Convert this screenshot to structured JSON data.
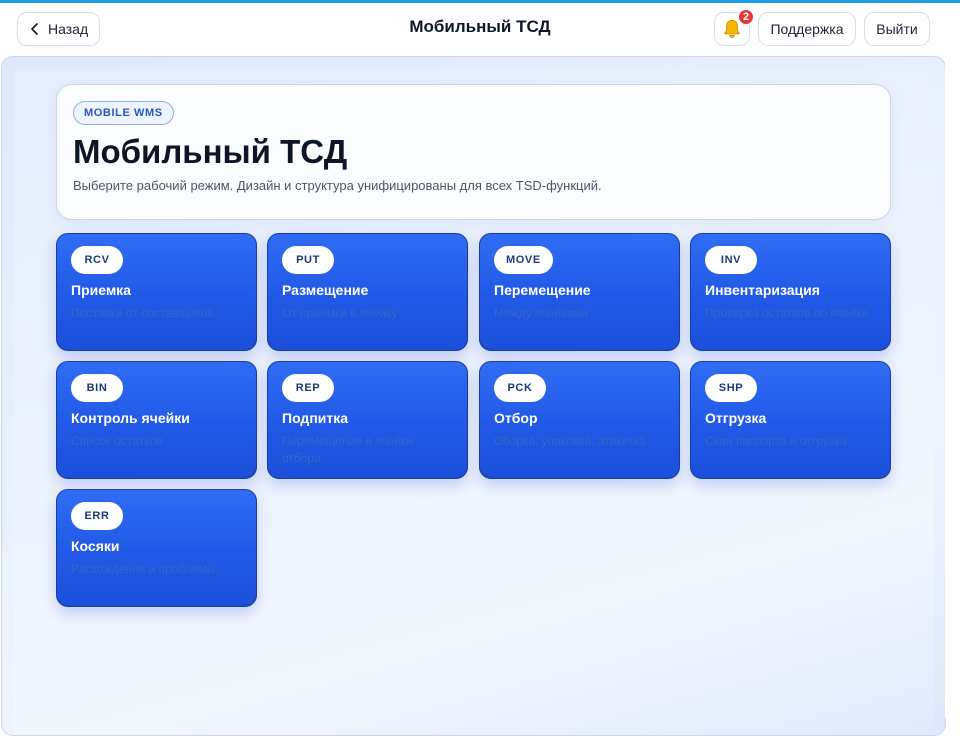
{
  "header": {
    "back_label": "Назад",
    "title": "Мобильный ТСД",
    "notifications_count": "2",
    "support_label": "Поддержка",
    "logout_label": "Выйти"
  },
  "hero": {
    "tag": "MOBILE WMS",
    "title": "Мобильный ТСД",
    "subtitle": "Выберите рабочий режим. Дизайн и структура унифицированы для всех TSD-функций."
  },
  "tiles": [
    {
      "code": "RCV",
      "title": "Приемка",
      "subtitle": "Поставки от поставщиков"
    },
    {
      "code": "PUT",
      "title": "Размещение",
      "subtitle": "От приемки в ячейку"
    },
    {
      "code": "MOVE",
      "title": "Перемещение",
      "subtitle": "Между ячейками"
    },
    {
      "code": "INV",
      "title": "Инвентаризация",
      "subtitle": "Проверка остатков по ячейке"
    },
    {
      "code": "BIN",
      "title": "Контроль ячейки",
      "subtitle": "Список остатков"
    },
    {
      "code": "REP",
      "title": "Подпитка",
      "subtitle": "Перемещение в ячейки отбора"
    },
    {
      "code": "PCK",
      "title": "Отбор",
      "subtitle": "Сборка, упаковка, этикетка"
    },
    {
      "code": "SHP",
      "title": "Отгрузка",
      "subtitle": "Скан паспорта и отгрузка"
    },
    {
      "code": "ERR",
      "title": "Косяки",
      "subtitle": "Расхождения и проблемы"
    }
  ],
  "colors": {
    "accent": "#1c9be8",
    "tile": "#2159e6",
    "badge": "#e53935"
  },
  "icons": {
    "back": "chevron-left-icon",
    "notifications": "bell-icon"
  }
}
